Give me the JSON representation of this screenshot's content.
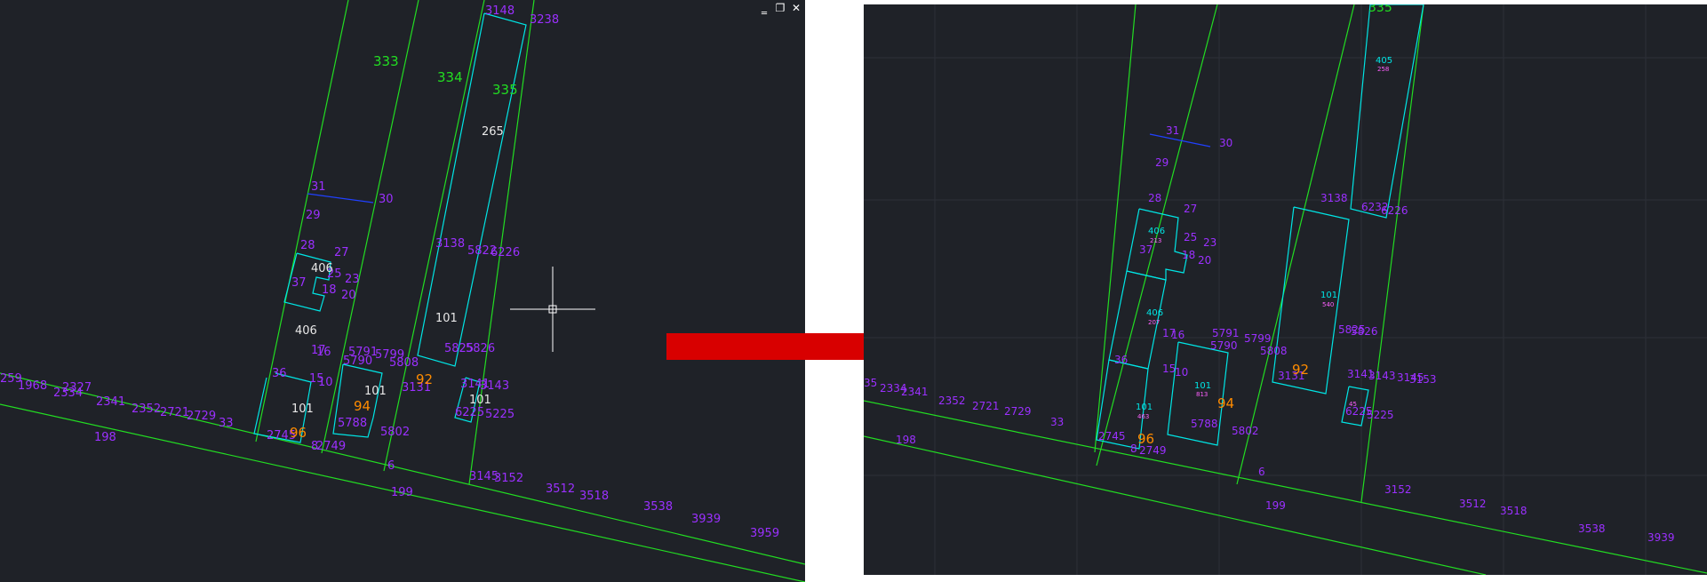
{
  "window": {
    "minimize_glyph": "‗",
    "restore_glyph": "❐",
    "close_glyph": "✕"
  },
  "colors": {
    "canvas_bg": "#1f2228",
    "parcel_line": "#22dd22",
    "building_line": "#00e5e5",
    "point_label": "#9b30ff",
    "parcel_label": "#22dd22",
    "orange_label": "#ff8c00",
    "white_label": "#e8e8e8",
    "arrow": "#d80000",
    "blue_line": "#2040ff"
  },
  "left_view": {
    "parcel_numbers": [
      "333",
      "334",
      "335"
    ],
    "point_labels": [
      "3148",
      "3238",
      "31",
      "30",
      "29",
      "28",
      "27",
      "37",
      "18",
      "23",
      "20",
      "25",
      "17",
      "16",
      "36",
      "15",
      "10",
      "5791",
      "5790",
      "5799",
      "5808",
      "3131",
      "5788",
      "5802",
      "3138",
      "5822",
      "6226",
      "5825",
      "5826",
      "3141",
      "3143",
      "3145",
      "3152",
      "6225",
      "5225",
      "2745",
      "8",
      "2749",
      "6",
      "2352",
      "2721",
      "2729",
      "33",
      "2334",
      "2341",
      "198",
      "199",
      "3512",
      "3518",
      "3538",
      "3939",
      "3959",
      "259",
      "1968",
      "2327"
    ],
    "white_labels": [
      "265",
      "406",
      "406",
      "101",
      "101",
      "101",
      "101"
    ],
    "orange_labels": [
      "92",
      "94",
      "96"
    ]
  },
  "right_view": {
    "parcel_numbers": [
      "335"
    ],
    "point_labels": [
      "31",
      "30",
      "29",
      "28",
      "27",
      "25",
      "23",
      "37",
      "18",
      "20",
      "17",
      "16",
      "36",
      "15",
      "10",
      "5791",
      "5790",
      "5799",
      "5808",
      "3131",
      "5788",
      "5802",
      "3138",
      "6232",
      "6226",
      "5825",
      "5826",
      "3141",
      "3143",
      "3145",
      "3153",
      "6225",
      "5225",
      "2745",
      "8",
      "2749",
      "6",
      "2352",
      "2721",
      "2729",
      "33",
      "2334",
      "2341",
      "198",
      "199",
      "3512",
      "3518",
      "3538",
      "3939",
      "3152",
      "35"
    ],
    "cyan_labels": [
      "405",
      "406",
      "406",
      "101",
      "101",
      "101"
    ],
    "small_labels": [
      "258",
      "213",
      "207",
      "463",
      "813",
      "540",
      "45"
    ],
    "orange_labels": [
      "92",
      "94",
      "96"
    ]
  }
}
